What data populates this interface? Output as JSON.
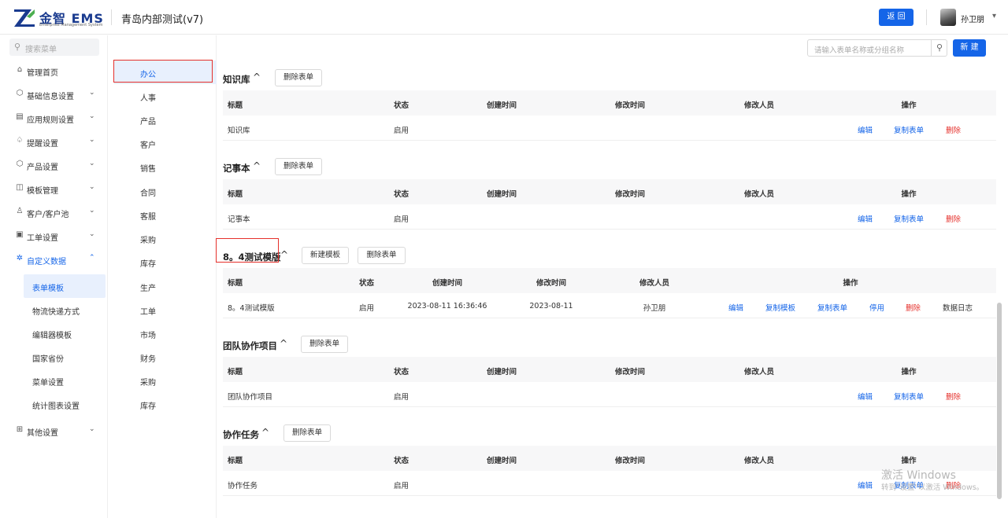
{
  "header": {
    "logo_text": "金智 EMS",
    "logo_tagline": "Enterprise Management System",
    "app_title": "青岛内部测试(v7)",
    "back_label": "返 回",
    "user_name": "孙卫朋"
  },
  "sidebar": {
    "search_placeholder": "搜索菜单",
    "items": [
      {
        "label": "管理首页",
        "icon": "home-icon"
      },
      {
        "label": "基础信息设置",
        "icon": "cube-icon"
      },
      {
        "label": "应用规则设置",
        "icon": "file-icon"
      },
      {
        "label": "提醒设置",
        "icon": "bell-icon"
      },
      {
        "label": "产品设置",
        "icon": "box-icon"
      },
      {
        "label": "模板管理",
        "icon": "template-icon"
      },
      {
        "label": "客户/客户池",
        "icon": "customer-icon"
      },
      {
        "label": "工单设置",
        "icon": "ticket-icon"
      },
      {
        "label": "自定义数据",
        "icon": "custom-data-icon"
      },
      {
        "label": "其他设置",
        "icon": "grid-icon"
      }
    ],
    "sub_items": [
      "表单模板",
      "物流快递方式",
      "编辑器模板",
      "国家省份",
      "菜单设置",
      "统计图表设置"
    ]
  },
  "categories": [
    "办公",
    "人事",
    "产品",
    "客户",
    "销售",
    "合同",
    "客服",
    "采购",
    "库存",
    "生产",
    "工单",
    "市场",
    "财务",
    "采购",
    "库存"
  ],
  "toolbar": {
    "search_placeholder": "请输入表单名称或分组名称",
    "new_label": "新 建"
  },
  "groups": [
    {
      "title": "知识库",
      "buttons": [
        "删除表单"
      ],
      "columns": [
        "标题",
        "状态",
        "创建时间",
        "修改时间",
        "修改人员",
        "操作"
      ],
      "row": {
        "title": "知识库",
        "status": "启用",
        "created": "",
        "modified": "",
        "modifier": ""
      },
      "actions": [
        "编辑",
        "复制表单",
        "删除"
      ]
    },
    {
      "title": "记事本",
      "buttons": [
        "删除表单"
      ],
      "columns": [
        "标题",
        "状态",
        "创建时间",
        "修改时间",
        "修改人员",
        "操作"
      ],
      "row": {
        "title": "记事本",
        "status": "启用",
        "created": "",
        "modified": "",
        "modifier": ""
      },
      "actions": [
        "编辑",
        "复制表单",
        "删除"
      ]
    },
    {
      "title": "8。4测试模版",
      "buttons": [
        "新建模板",
        "删除表单"
      ],
      "columns": [
        "标题",
        "状态",
        "创建时间",
        "修改时间",
        "修改人员",
        "操作"
      ],
      "row": {
        "title": "8。4测试模版",
        "status": "启用",
        "created": "2023-08-11 16:36:46",
        "modified": "2023-08-11",
        "modifier": "孙卫朋"
      },
      "actions": [
        "编辑",
        "复制模板",
        "复制表单",
        "停用",
        "删除",
        "数据日志"
      ]
    },
    {
      "title": "团队协作项目",
      "buttons": [
        "删除表单"
      ],
      "columns": [
        "标题",
        "状态",
        "创建时间",
        "修改时间",
        "修改人员",
        "操作"
      ],
      "row": {
        "title": "团队协作项目",
        "status": "启用",
        "created": "",
        "modified": "",
        "modifier": ""
      },
      "actions": [
        "编辑",
        "复制表单",
        "删除"
      ]
    },
    {
      "title": "协作任务",
      "buttons": [
        "删除表单"
      ],
      "columns": [
        "标题",
        "状态",
        "创建时间",
        "修改时间",
        "修改人员",
        "操作"
      ],
      "row": {
        "title": "协作任务",
        "status": "启用",
        "created": "",
        "modified": "",
        "modifier": ""
      },
      "actions": [
        "编辑",
        "复制表单",
        "删除"
      ]
    }
  ],
  "watermark": {
    "line1": "激活 Windows",
    "line2": "转到\"设置\"以激活 Windows。"
  },
  "colors": {
    "primary": "#1565e8",
    "danger": "#e5302b",
    "highlight_box": "#e5302b",
    "selected_bg": "#e8f0fd"
  }
}
